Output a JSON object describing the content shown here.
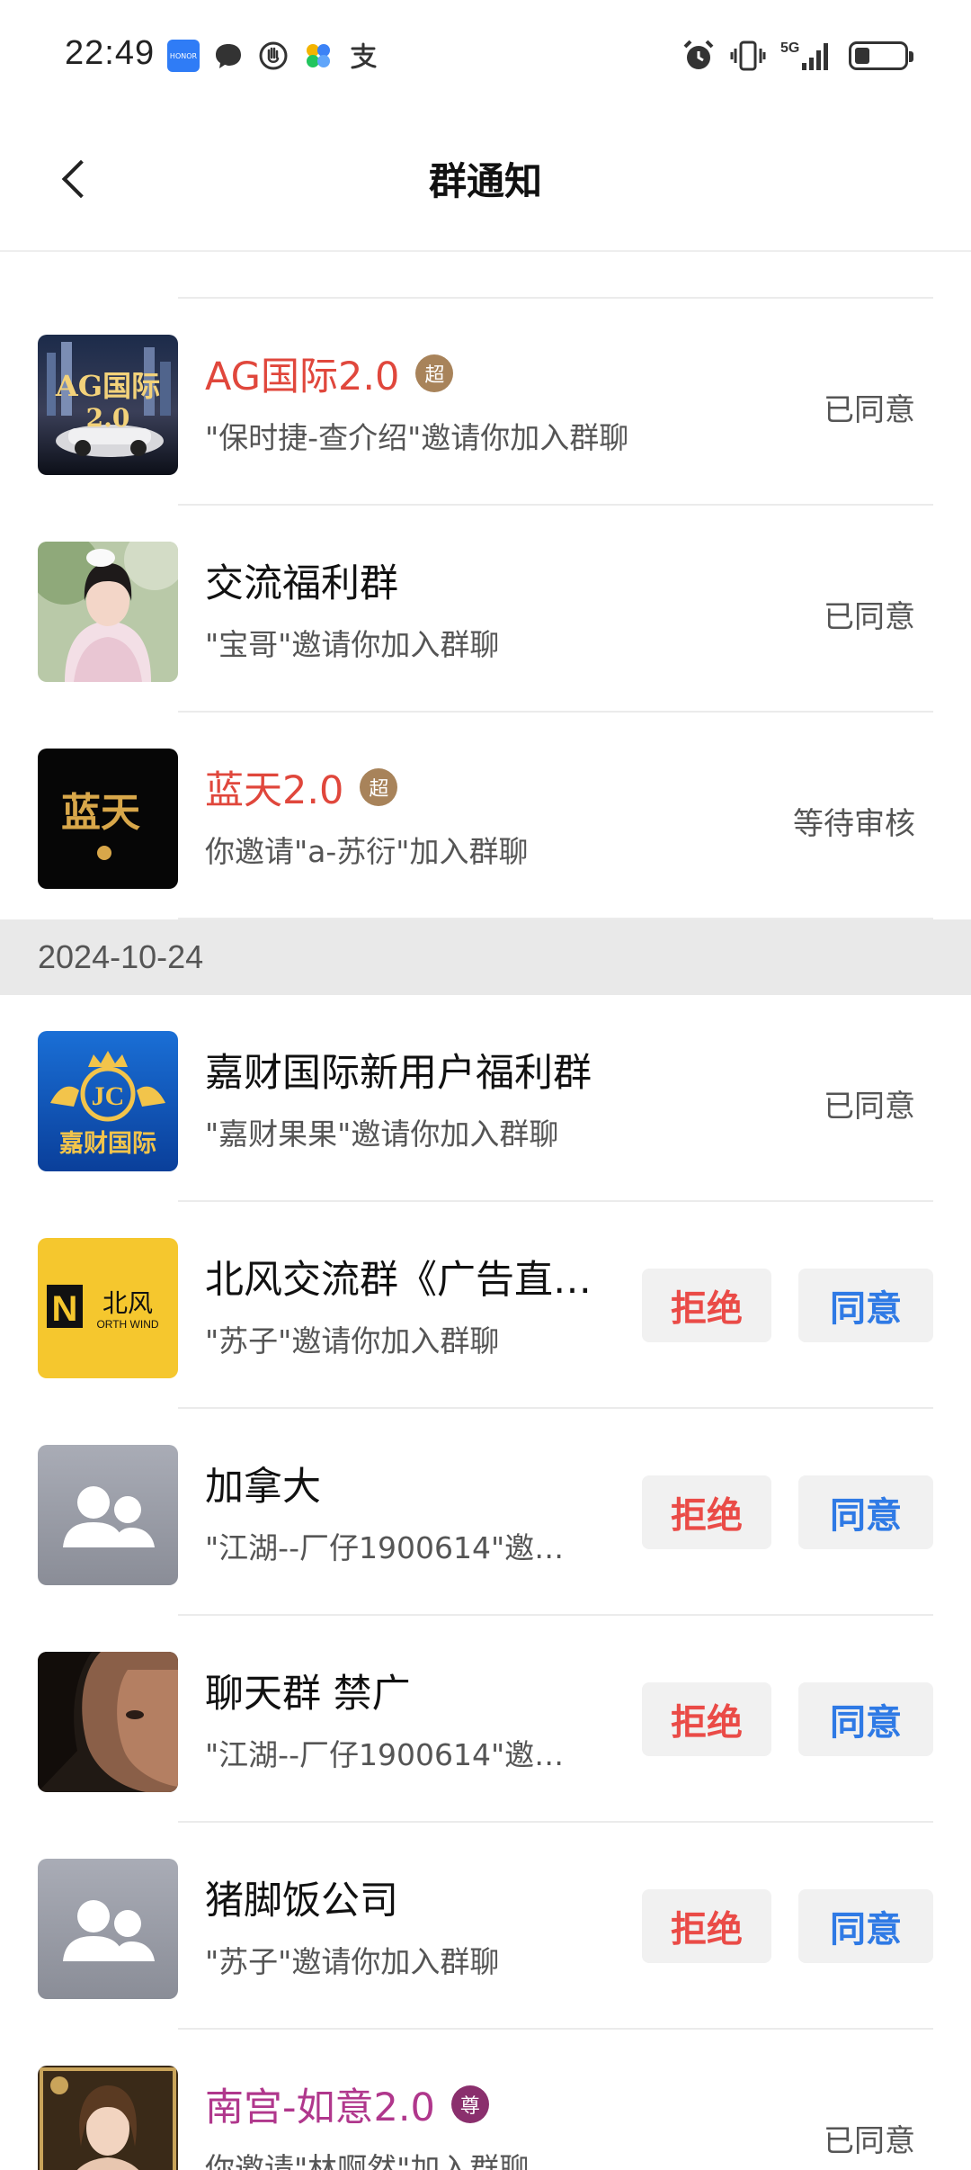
{
  "status_bar": {
    "time": "22:49",
    "left_icons": [
      "honor-icon",
      "message-icon",
      "hand-icon",
      "pinwheel-icon",
      "alipay-icon"
    ],
    "right_icons": [
      "alarm-icon",
      "vibrate-icon",
      "5g-signal-icon",
      "battery-icon"
    ],
    "network": "5G",
    "battery_level": 0.3
  },
  "header": {
    "title": "群通知",
    "back_icon": "chevron-left-icon"
  },
  "buttons": {
    "reject": "拒绝",
    "accept": "同意"
  },
  "section_1": {
    "items": [
      {
        "name": "AG国际2.0",
        "badge": "超",
        "invite": "\"保时捷-查介绍\"邀请你加入群聊",
        "status": "已同意"
      },
      {
        "name": "交流福利群",
        "invite": "\"宝哥\"邀请你加入群聊",
        "status": "已同意"
      },
      {
        "name": "蓝天2.0",
        "badge": "超",
        "invite": "你邀请\"a-苏衍\"加入群聊",
        "status": "等待审核"
      }
    ]
  },
  "section_2": {
    "date": "2024-10-24",
    "items": [
      {
        "name": "嘉财国际新用户福利群",
        "invite": "\"嘉财果果\"邀请你加入群聊",
        "status": "已同意"
      },
      {
        "name": "北风交流群《广告直…",
        "invite": "\"苏子\"邀请你加入群聊"
      },
      {
        "name": "加拿大",
        "invite": "\"江湖--厂仔1900614\"邀…"
      },
      {
        "name": "聊天群 禁广",
        "invite": "\"江湖--厂仔1900614\"邀…"
      },
      {
        "name": "猪脚饭公司",
        "invite": "\"苏子\"邀请你加入群聊"
      },
      {
        "name": "南宫-如意2.0",
        "badge": "尊",
        "invite": "你邀请\"林啊然\"加入群聊",
        "status": "已同意"
      }
    ]
  },
  "avatar_text": {
    "ag": "AG国际",
    "ag_sub": "2.0",
    "lantian": "蓝天",
    "jiacai": "嘉财国际",
    "jiacai_logo": "JC",
    "beifeng_n": "N",
    "beifeng_cn": "北风",
    "beifeng_en": "ORTH WIND"
  },
  "colors": {
    "accent_red": "#e0473c",
    "reject_red": "#ea4b47",
    "accept_blue": "#2f7ae5",
    "badge_gold": "#a8835a",
    "badge_purple": "#8a2f6d",
    "date_bg": "#e9e9e9"
  }
}
